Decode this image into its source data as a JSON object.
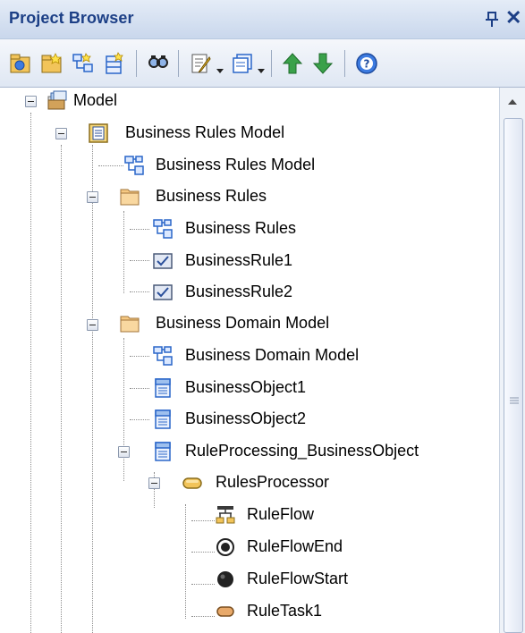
{
  "window": {
    "title": "Project Browser",
    "pin_icon": "pin-icon",
    "close_label": "✕"
  },
  "toolbar": {
    "buttons": [
      {
        "name": "new-model-icon"
      },
      {
        "name": "new-package-icon"
      },
      {
        "name": "new-diagram-icon"
      },
      {
        "name": "new-element-icon"
      },
      {
        "name": "find-icon"
      },
      {
        "name": "properties-icon"
      },
      {
        "name": "layout-icon"
      },
      {
        "name": "move-up-icon"
      },
      {
        "name": "move-down-icon"
      },
      {
        "name": "help-icon"
      }
    ]
  },
  "tree": {
    "items": [
      {
        "label": "Model",
        "icon": "model-root-icon",
        "expanded": true
      },
      {
        "label": "Business Rules Model",
        "icon": "package-view-icon",
        "expanded": true
      },
      {
        "label": "Business Rules Model",
        "icon": "diagram-icon"
      },
      {
        "label": "Business Rules",
        "icon": "folder-icon",
        "expanded": true
      },
      {
        "label": "Business Rules",
        "icon": "diagram-icon"
      },
      {
        "label": "BusinessRule1",
        "icon": "rule-icon"
      },
      {
        "label": "BusinessRule2",
        "icon": "rule-icon"
      },
      {
        "label": "Business Domain Model",
        "icon": "folder-icon",
        "expanded": true
      },
      {
        "label": "Business Domain Model",
        "icon": "diagram-icon"
      },
      {
        "label": "BusinessObject1",
        "icon": "class-icon"
      },
      {
        "label": "BusinessObject2",
        "icon": "class-icon"
      },
      {
        "label": "RuleProcessing_BusinessObject",
        "icon": "class-icon",
        "expanded": true
      },
      {
        "label": "RulesProcessor",
        "icon": "operation-icon",
        "expanded": true
      },
      {
        "label": "RuleFlow",
        "icon": "activity-diagram-icon"
      },
      {
        "label": "RuleFlowEnd",
        "icon": "final-node-icon"
      },
      {
        "label": "RuleFlowStart",
        "icon": "initial-node-icon"
      },
      {
        "label": "RuleTask1",
        "icon": "action-icon"
      }
    ]
  },
  "colors": {
    "title_text": "#1c3f86",
    "header_gradient_top": "#e4ecf7",
    "header_gradient_bottom": "#c9d7ec",
    "folder_fill": "#f6c983",
    "diagram_blue": "#2a66c9"
  }
}
